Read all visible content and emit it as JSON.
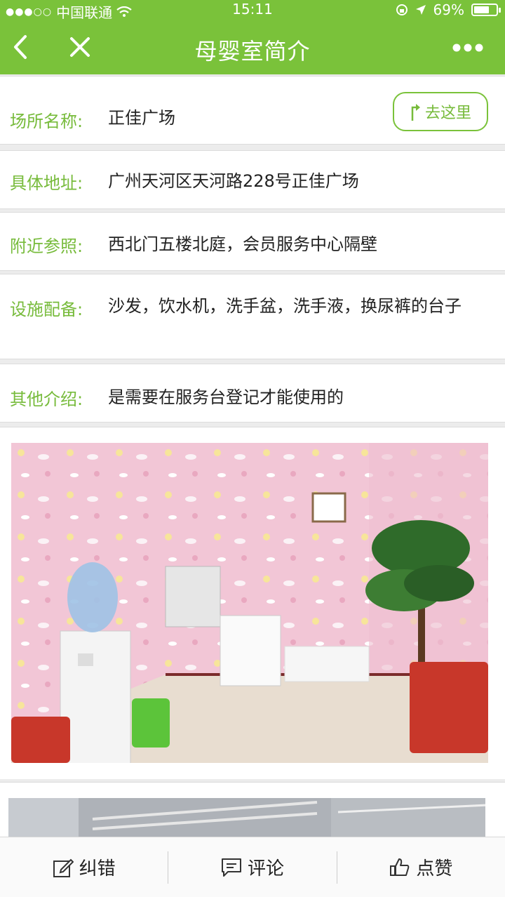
{
  "status_bar": {
    "carrier": "中国联通",
    "time": "15:11",
    "battery": "69%",
    "battery_level": 0.69
  },
  "nav": {
    "title": "母婴室简介"
  },
  "info": {
    "name": {
      "label": "场所名称:",
      "value": "正佳广场"
    },
    "goto_label": "去这里",
    "address": {
      "label": "具体地址:",
      "value": "广州天河区天河路228号正佳广场"
    },
    "nearby": {
      "label": "附近参照:",
      "value": "西北门五楼北庭，会员服务中心隔壁"
    },
    "facilities": {
      "label": "设施配备:",
      "value": "沙发，饮水机，洗手盆，洗手液，换尿裤的台子"
    },
    "other": {
      "label": "其他介绍:",
      "value": "是需要在服务台登记才能使用的"
    }
  },
  "bottom_bar": {
    "report": "纠错",
    "comment": "评论",
    "like": "点赞"
  },
  "colors": {
    "brand_green": "#7ac23a",
    "label_green": "#77bb3b"
  }
}
